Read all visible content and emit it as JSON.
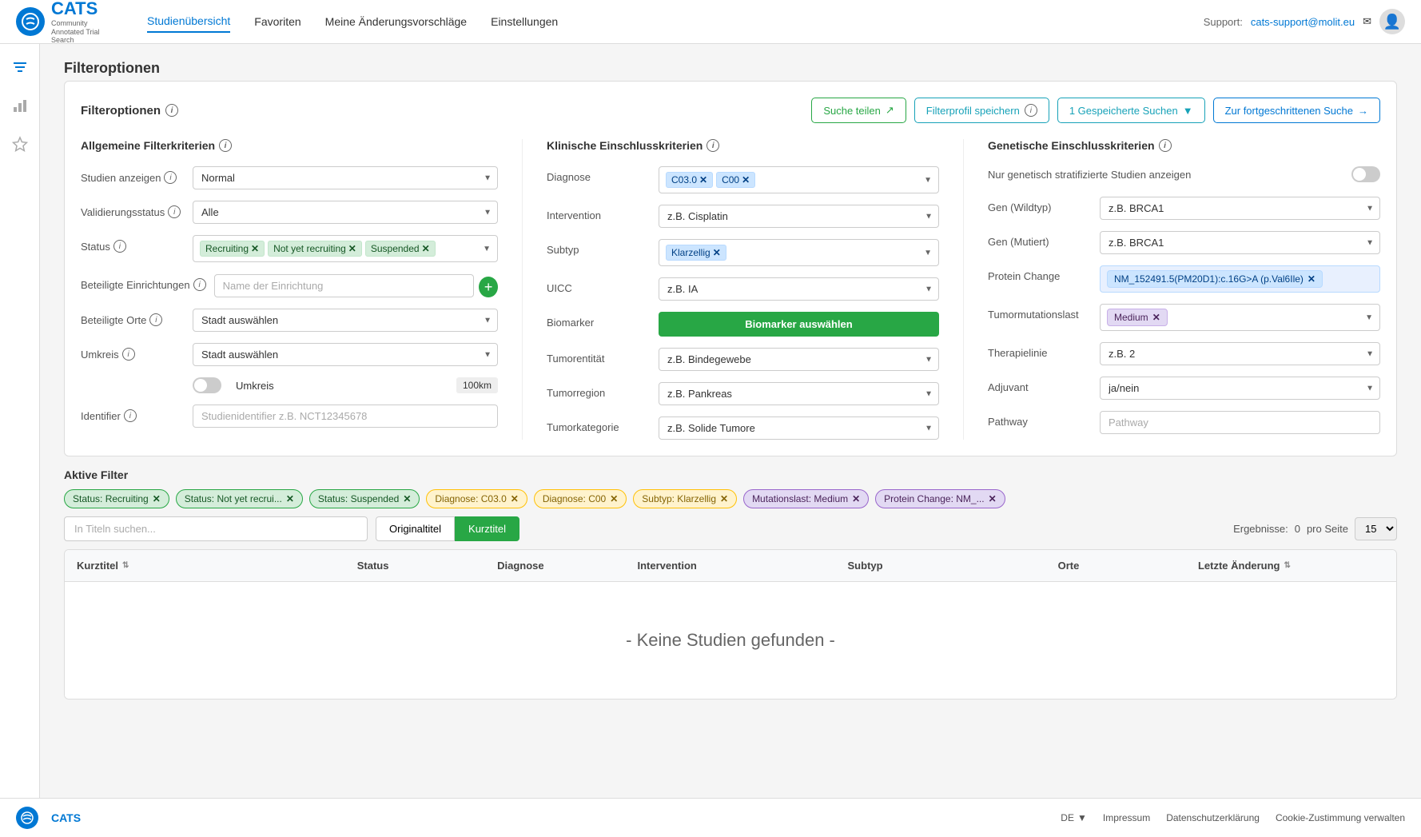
{
  "app": {
    "logo_text": "CATS",
    "logo_subtitle": "Community Annotated Trial Search",
    "footer_logo": "CATS"
  },
  "header": {
    "nav_items": [
      {
        "label": "Studienübersicht",
        "active": true
      },
      {
        "label": "Favoriten",
        "active": false
      },
      {
        "label": "Meine Änderungsvorschläge",
        "active": false
      },
      {
        "label": "Einstellungen",
        "active": false
      }
    ],
    "support_text": "Support:",
    "support_email": "cats-support@molit.eu"
  },
  "filter_section": {
    "title": "Filteroptionen",
    "buttons": {
      "share": "Suche teilen",
      "save_profile": "Filterprofil speichern",
      "saved_searches": "1 Gespeicherte Suchen",
      "advanced_search": "Zur fortgeschrittenen Suche"
    }
  },
  "general_filters": {
    "title": "Allgemeine Filterkriterien",
    "studien_anzeigen": {
      "label": "Studien anzeigen",
      "value": "Normal"
    },
    "validierungsstatus": {
      "label": "Validierungsstatus",
      "value": "Alle"
    },
    "status": {
      "label": "Status",
      "tags": [
        {
          "label": "Recruiting",
          "color": "green"
        },
        {
          "label": "Not yet recruiting",
          "color": "green"
        },
        {
          "label": "Suspended",
          "color": "green"
        }
      ]
    },
    "einrichtungen": {
      "label": "Beteiligte Einrichtungen",
      "placeholder": "Name der Einrichtung"
    },
    "orte": {
      "label": "Beteiligte Orte",
      "placeholder": "Stadt auswählen"
    },
    "umkreis_label": "Umkreis",
    "umkreis_placeholder": "Stadt auswählen",
    "umkreis_toggle": false,
    "umkreis_value": "100km",
    "identifier": {
      "label": "Identifier",
      "placeholder": "Studienidentifier z.B. NCT12345678"
    }
  },
  "clinical_filters": {
    "title": "Klinische Einschlusskriterien",
    "diagnose": {
      "label": "Diagnose",
      "tags": [
        {
          "label": "C03.0",
          "color": "blue"
        },
        {
          "label": "C00",
          "color": "blue"
        }
      ]
    },
    "intervention": {
      "label": "Intervention",
      "placeholder": "z.B. Cisplatin"
    },
    "subtyp": {
      "label": "Subtyp",
      "tags": [
        {
          "label": "Klarzellig",
          "color": "blue"
        }
      ]
    },
    "uicc": {
      "label": "UICC",
      "placeholder": "z.B. IA"
    },
    "biomarker": {
      "label": "Biomarker",
      "button_label": "Biomarker auswählen"
    },
    "tumorentitaet": {
      "label": "Tumorentität",
      "placeholder": "z.B. Bindegewebe"
    },
    "tumorregion": {
      "label": "Tumorregion",
      "placeholder": "z.B. Pankreas"
    },
    "tumorkategorie": {
      "label": "Tumorkategorie",
      "placeholder": "z.B. Solide Tumore"
    }
  },
  "genetic_filters": {
    "title": "Genetische Einschlusskriterien",
    "toggle_label": "Nur genetisch stratifizierte Studien anzeigen",
    "gen_wildtyp": {
      "label": "Gen (Wildtyp)",
      "placeholder": "z.B. BRCA1"
    },
    "gen_mutiert": {
      "label": "Gen (Mutiert)",
      "placeholder": "z.B. BRCA1"
    },
    "protein_change": {
      "label": "Protein Change",
      "tag": "NM_152491.5(PM20D1):c.16G>A (p.Val6Ile)"
    },
    "tumormutationslast": {
      "label": "Tumormutationslast",
      "tag": "Medium"
    },
    "therapielinie": {
      "label": "Therapielinie",
      "placeholder": "z.B. 2"
    },
    "adjuvant": {
      "label": "Adjuvant",
      "placeholder": "ja/nein"
    },
    "pathway": {
      "label": "Pathway",
      "placeholder": "Pathway"
    }
  },
  "active_filters": {
    "title": "Aktive Filter",
    "chips": [
      {
        "label": "Status: Recruiting",
        "color": "green"
      },
      {
        "label": "Status: Not yet recrui...",
        "color": "green"
      },
      {
        "label": "Status: Suspended",
        "color": "green"
      },
      {
        "label": "Diagnose: C03.0",
        "color": "yellow"
      },
      {
        "label": "Diagnose: C00",
        "color": "yellow"
      },
      {
        "label": "Subtyp: Klarzellig",
        "color": "yellow"
      },
      {
        "label": "Mutationslast: Medium",
        "color": "purple"
      },
      {
        "label": "Protein Change: NM_...",
        "color": "purple"
      }
    ]
  },
  "search_bar": {
    "placeholder": "In Titeln suchen...",
    "tab_original": "Originaltitel",
    "tab_kurz": "Kurztitel",
    "results_label": "Ergebnisse:",
    "results_count": "0",
    "per_page_label": "pro Seite",
    "per_page_value": "15"
  },
  "table": {
    "columns": [
      {
        "label": "Kurztitel",
        "sortable": true
      },
      {
        "label": "Status",
        "sortable": false
      },
      {
        "label": "Diagnose",
        "sortable": false
      },
      {
        "label": "Intervention",
        "sortable": false
      },
      {
        "label": "Subtyp",
        "sortable": false
      },
      {
        "label": "Orte",
        "sortable": false
      },
      {
        "label": "Letzte Änderung",
        "sortable": true
      }
    ],
    "no_results": "- Keine Studien gefunden -"
  },
  "footer": {
    "language": "DE",
    "links": [
      {
        "label": "Impressum"
      },
      {
        "label": "Datenschutzerklärung"
      },
      {
        "label": "Cookie-Zustimmung verwalten"
      }
    ]
  }
}
